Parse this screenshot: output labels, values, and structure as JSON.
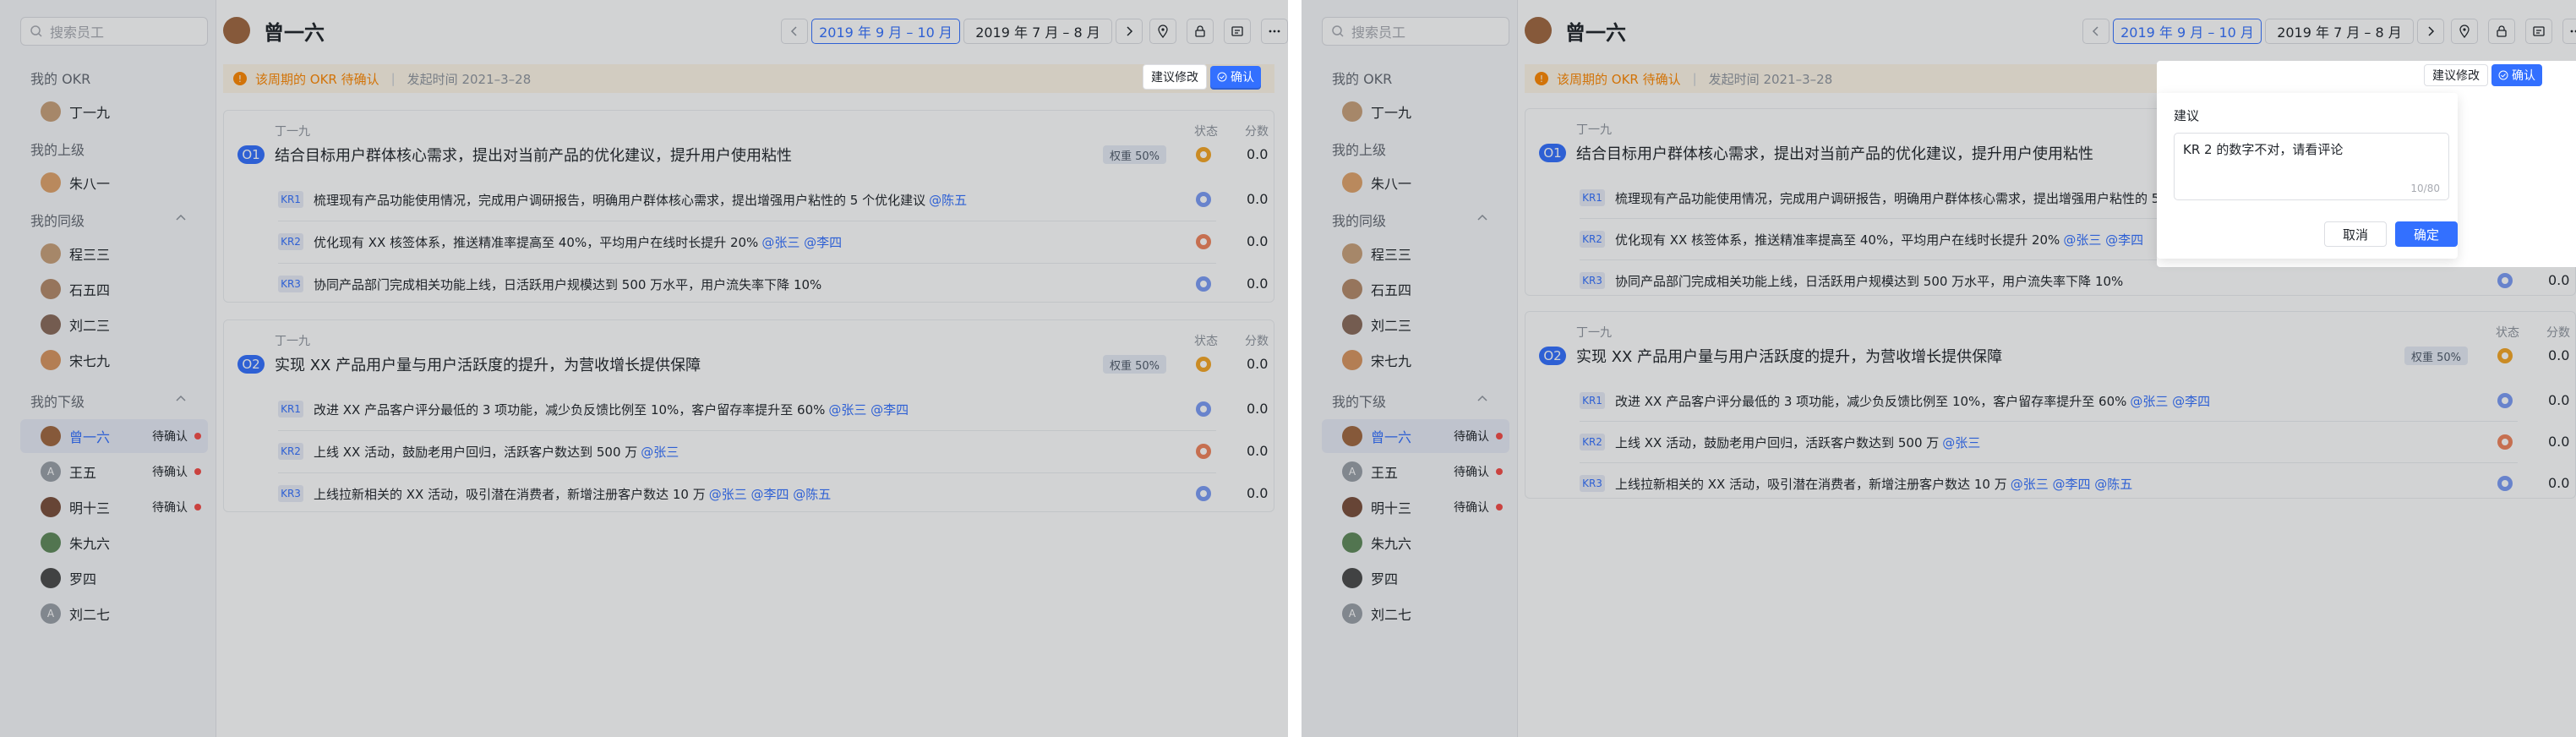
{
  "search": {
    "placeholder": "搜索员工"
  },
  "sections": {
    "my_okr": "我的 OKR",
    "my_superior": "我的上级",
    "my_peers": "我的同级",
    "my_subordinates": "我的下级"
  },
  "people": {
    "me": "丁一九",
    "superior": "朱八一",
    "peers": [
      "程三三",
      "石五四",
      "刘二三",
      "宋七九"
    ],
    "subordinates": [
      "曾一六",
      "王五",
      "明十三",
      "朱九六",
      "罗四",
      "刘二七"
    ]
  },
  "pending_label": "待确认",
  "header": {
    "title": "曾一六",
    "period_active": "2019 年 9 月 – 10 月",
    "period_other": "2019 年 7 月 – 8 月"
  },
  "notice": {
    "message": "该周期的 OKR 待确认",
    "date": "发起时间 2021–3–28"
  },
  "actions": {
    "suggest": "建议修改",
    "confirm": "确认"
  },
  "cols": {
    "status": "状态",
    "score": "分数"
  },
  "objectives": [
    {
      "owner": "丁一九",
      "badge": "O1",
      "title": "结合目标用户群体核心需求，提出对当前产品的优化建议，提升用户使用粘性",
      "weight": "权重 50%",
      "status_color": "#f5a623",
      "score": "0.0",
      "krs": [
        {
          "badge": "KR1",
          "text": "梳理现有产品功能使用情况，完成用户调研报告，明确用户群体核心需求，提出增强用户粘性的 5 个优化建议",
          "mention": "@陈五",
          "status_color": "#7b9cf5",
          "score": "0.0"
        },
        {
          "badge": "KR2",
          "text": "优化现有 XX 核签体系，推送精准率提高至 40%，平均用户在线时长提升 20%",
          "mention": "@张三 @李四",
          "status_color": "#f0835a",
          "score": "0.0"
        },
        {
          "badge": "KR3",
          "text": "协同产品部门完成相关功能上线，日活跃用户规模达到 500 万水平，用户流失率下降 10%",
          "mention": "",
          "status_color": "#7b9cf5",
          "score": "0.0"
        }
      ]
    },
    {
      "owner": "丁一九",
      "badge": "O2",
      "title": "实现 XX 产品用户量与用户活跃度的提升，为营收增长提供保障",
      "weight": "权重 50%",
      "status_color": "#f5a623",
      "score": "0.0",
      "krs": [
        {
          "badge": "KR1",
          "text": "改进 XX 产品客户评分最低的 3 项功能，减少负反馈比例至 10%，客户留存率提升至 60%",
          "mention": "@张三 @李四",
          "status_color": "#7b9cf5",
          "score": "0.0"
        },
        {
          "badge": "KR2",
          "text": "上线 XX 活动，鼓励老用户回归，活跃客户数达到 500 万",
          "mention": "@张三",
          "status_color": "#f0835a",
          "score": "0.0"
        },
        {
          "badge": "KR3",
          "text": "上线拉新相关的 XX 活动，吸引潜在消费者，新增注册客户数达 10 万",
          "mention": "@张三 @李四 @陈五",
          "status_color": "#7b9cf5",
          "score": "0.0"
        }
      ]
    }
  ],
  "popover": {
    "label": "建议",
    "text": "KR 2 的数字不对，请看评论",
    "count": "10/80",
    "cancel": "取消",
    "ok": "确定"
  },
  "colors": {
    "accent": "#3370ff",
    "warning": "#ff8800",
    "pending_dot": "#f54a45"
  }
}
